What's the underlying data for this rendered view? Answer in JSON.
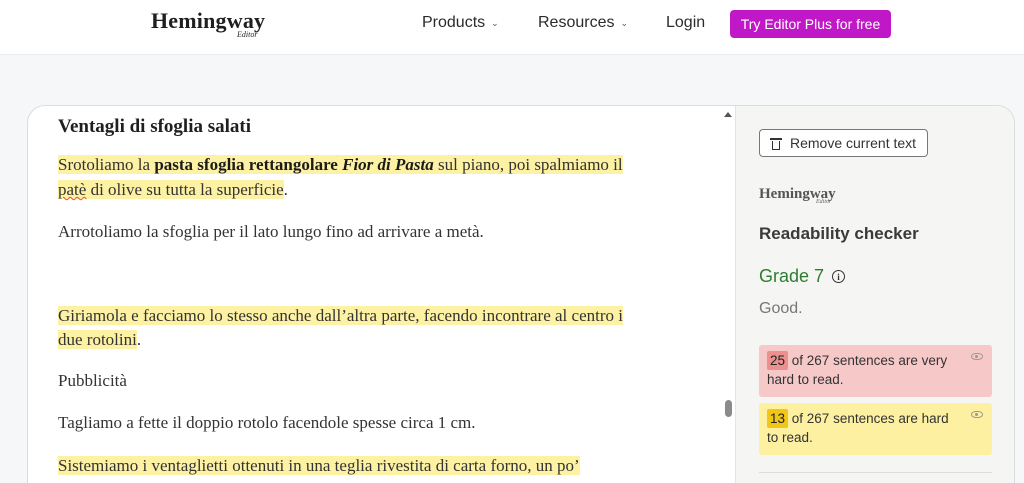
{
  "nav": {
    "logo": "Hemingway",
    "logo_sub": "Editor",
    "products": "Products",
    "resources": "Resources",
    "login": "Login",
    "cta": "Try Editor Plus for free"
  },
  "editor": {
    "title": "Ventagli di sfoglia salati",
    "p1": {
      "a": "Srotoliamo la ",
      "b": "pasta sfoglia rettangolare ",
      "c": "Fior di Pasta",
      "d": " sul piano, poi spalmiamo il",
      "e": "patè",
      "f": " di olive su tutta la superficie",
      "g": "."
    },
    "p2": "Arrotoliamo la sfoglia per il lato lungo fino ad arrivare a metà.",
    "p3": {
      "line1": "Giriamola e facciamo lo stesso anche dall’altra parte, facendo incontrare al centro i",
      "line2": "due rotolini",
      "end": "."
    },
    "p4": "Pubblicità",
    "p5": "Tagliamo a fette il doppio rotolo facendole spesse circa 1 cm.",
    "p6": {
      "line1": "Sistemiamo i ventaglietti ottenuti in una teglia rivestita di carta forno, un po’"
    }
  },
  "panel": {
    "remove": "Remove current text",
    "logo": "Hemingway",
    "logo_sub": "Editor",
    "title": "Readability checker",
    "grade": "Grade 7",
    "rating": "Good.",
    "very_hard": {
      "count": "25",
      "text": " of 267 sentences are very hard to read."
    },
    "hard": {
      "count": "13",
      "text": " of 267 sentences are hard to read."
    }
  },
  "colors": {
    "cta": "#c118c7",
    "yellow_highlight": "#fdf1a3",
    "red_highlight": "#f7c8c8",
    "grade_green": "#2e7d32"
  },
  "icons": {
    "products_chevron": "chevron-down-icon",
    "resources_chevron": "chevron-down-icon",
    "remove": "trash-icon",
    "grade_info": "info-icon",
    "stat_toggle": "eye-icon"
  }
}
